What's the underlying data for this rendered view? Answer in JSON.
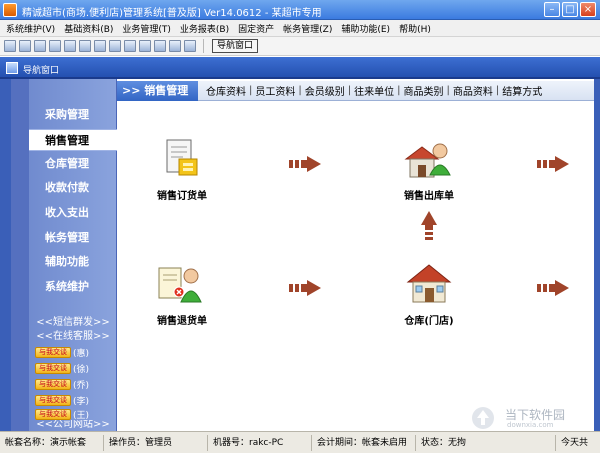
{
  "window": {
    "title": "精诚超市(商场.便利店)管理系统[普及版] Ver14.0612  -  某超市专用"
  },
  "menu": [
    "系统维护(V)",
    "基础资料(B)",
    "业务管理(T)",
    "业务报表(B)",
    "固定资产",
    "帐务管理(Z)",
    "辅助功能(E)",
    "帮助(H)"
  ],
  "toolbar": {
    "nav_button_label": "导航窗口"
  },
  "navstrip": {
    "title": "导航窗口"
  },
  "sidebar": {
    "items": [
      {
        "label": "采购管理",
        "active": false
      },
      {
        "label": "销售管理",
        "active": true
      },
      {
        "label": "仓库管理",
        "active": false
      },
      {
        "label": "收款付款",
        "active": false
      },
      {
        "label": "收入支出",
        "active": false
      },
      {
        "label": "帐务管理",
        "active": false
      },
      {
        "label": "辅助功能",
        "active": false
      },
      {
        "label": "系统维护",
        "active": false
      }
    ],
    "sms_link": "<<短信群发>>",
    "service_link": "<<在线客服>>",
    "qq_badge": "与我交谈",
    "qq_contacts": [
      "(惠)",
      "(徐)",
      "(乔)",
      "(李)",
      "(王)"
    ],
    "site_link": "<<公司网站>>"
  },
  "main": {
    "section_title": ">> 销售管理",
    "tabs": [
      "仓库资料",
      "员工资料",
      "会员级别",
      "往来单位",
      "商品类别",
      "商品资料",
      "结算方式"
    ],
    "tab_separator": "|",
    "modules": {
      "sales_order": "销售订货单",
      "sales_outbound": "销售出库单",
      "sales_return": "销售退货单",
      "warehouse": "仓库(门店)"
    }
  },
  "status": {
    "account": "帐套名称：演示帐套",
    "operator": "操作员：管理员",
    "machine": "机器号：rakc-PC",
    "period": "会计期间：帐套未启用",
    "state": "状态：无拘",
    "today": "今天共"
  },
  "watermark": {
    "title": "当下软件园",
    "subtitle": "downxia.com"
  },
  "colors": {
    "frame_blue": "#3a5fb8",
    "sidebar_blue": "#7a95d6",
    "arrow_brown": "#a0442a"
  }
}
